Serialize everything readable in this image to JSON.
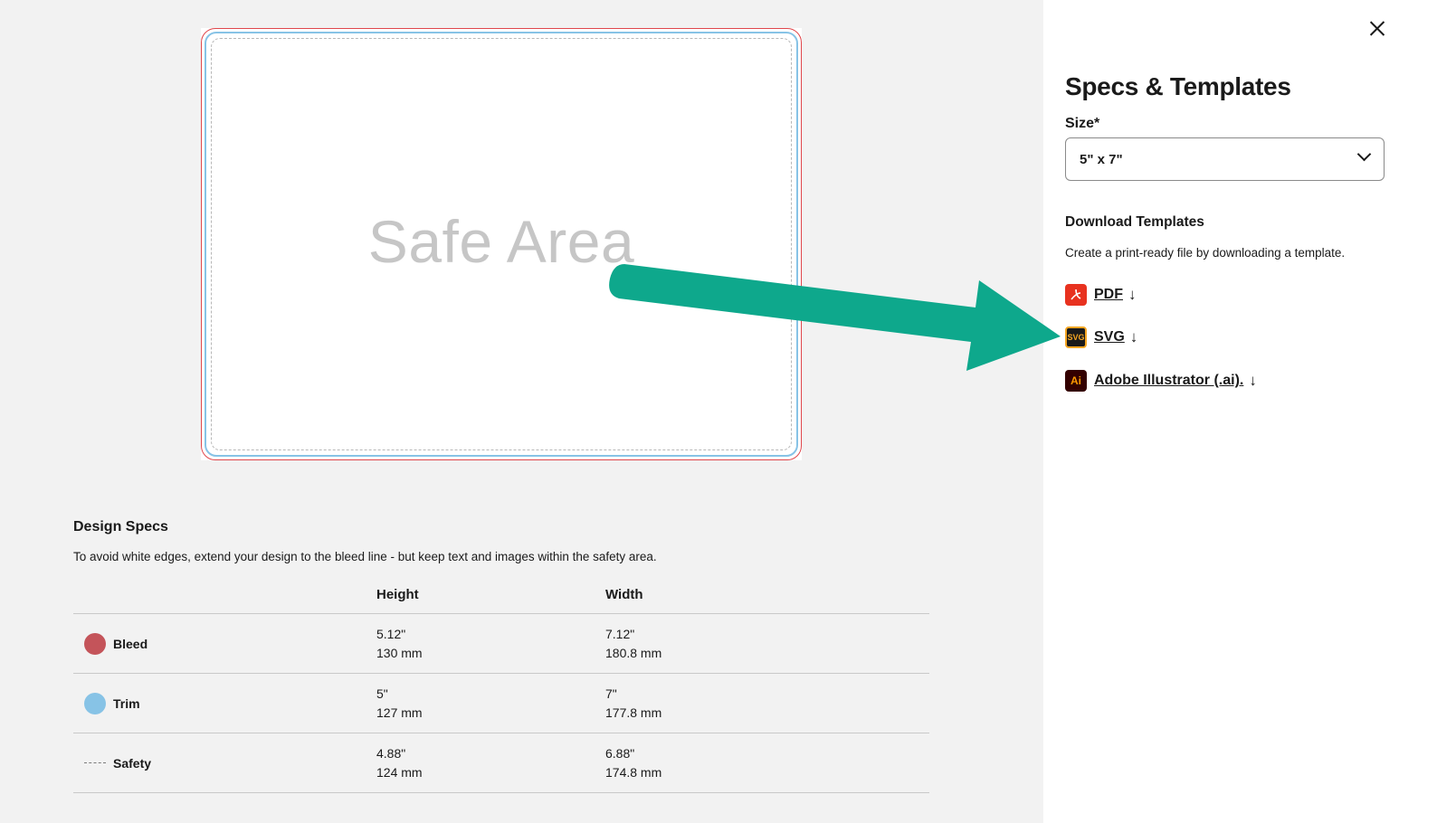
{
  "preview": {
    "safe_area_label": "Safe Area"
  },
  "design_specs": {
    "title": "Design Specs",
    "description": "To avoid white edges, extend your design to the bleed line - but keep text and images within the safety area.",
    "headers": {
      "height": "Height",
      "width": "Width"
    },
    "rows": [
      {
        "label": "Bleed",
        "swatch": "#c4545a",
        "height_in": "5.12\"",
        "height_mm": "130 mm",
        "width_in": "7.12\"",
        "width_mm": "180.8 mm"
      },
      {
        "label": "Trim",
        "swatch": "#87c3e6",
        "height_in": "5\"",
        "height_mm": "127 mm",
        "width_in": "7\"",
        "width_mm": "177.8 mm"
      },
      {
        "label": "Safety",
        "swatch": "dashed",
        "height_in": "4.88\"",
        "height_mm": "124 mm",
        "width_in": "6.88\"",
        "width_mm": "174.8 mm"
      }
    ]
  },
  "panel": {
    "title": "Specs & Templates",
    "size_label": "Size*",
    "size_value": "5\" x 7\"",
    "download_title": "Download Templates",
    "download_desc": "Create a print-ready file by downloading a template.",
    "links": [
      {
        "label": "PDF",
        "icon": "pdf-icon"
      },
      {
        "label": "SVG",
        "icon": "svg-icon"
      },
      {
        "label": "Adobe Illustrator (.ai).",
        "icon": "ai-icon"
      }
    ],
    "arrow_glyph": "↓"
  },
  "annotation": {
    "arrow_color": "#0ea88c"
  }
}
